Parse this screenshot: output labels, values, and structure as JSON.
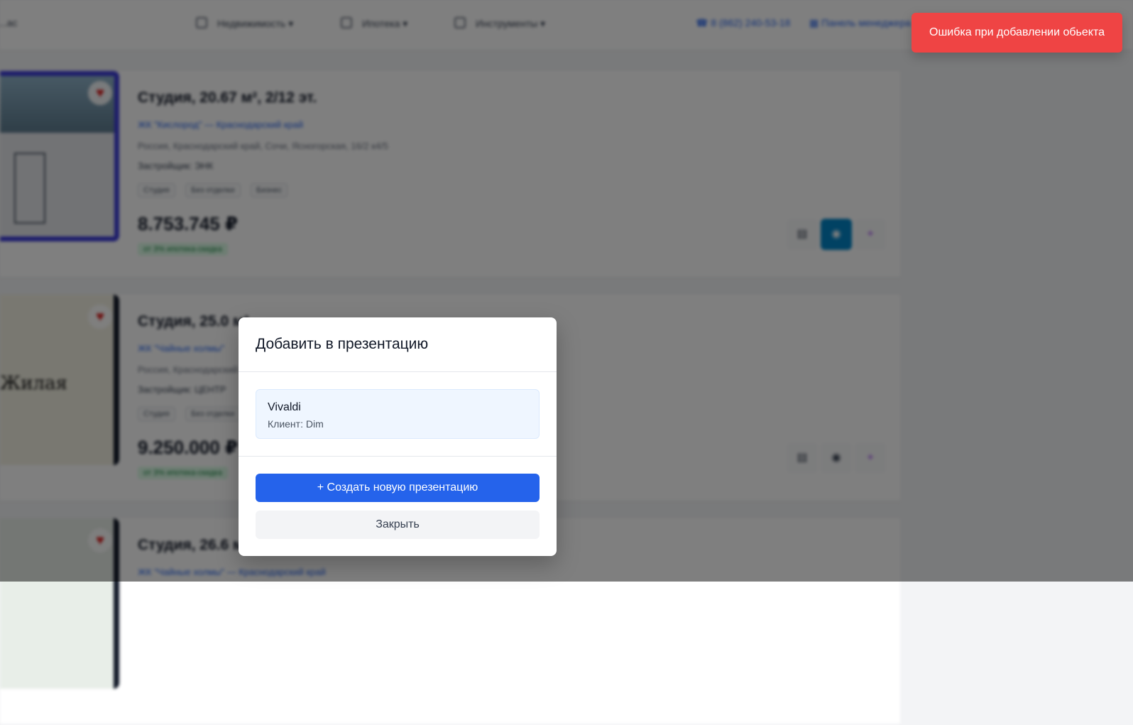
{
  "background": {
    "header": {
      "city_label": "...ас",
      "nav": [
        "Недвижимость",
        "Ипотека",
        "Инструменты"
      ],
      "phone": "8 (862) 240-53-18",
      "manager_link": "Панель менеджера"
    },
    "cards": [
      {
        "title": "Студия, 20.67 м², 2/12 эт.",
        "complex": "ЖК \"Кислород\" — Краснодарский край",
        "address": "Россия, Краснодарский край, Сочи, Ясногорская, 16/2 к4/5",
        "developer": "Застройщик: ЭНК",
        "tags": [
          "Студия",
          "Без отделки",
          "Бизнес"
        ],
        "price": "8.753.745 ₽",
        "promo": "от 3% ипотека-скидка"
      },
      {
        "title": "Студия, 25.0 м²",
        "complex": "ЖК \"Чайные холмы\"",
        "address": "Россия, Краснодарский край",
        "developer": "Застройщик: ЦЕНТР",
        "tags": [
          "Студия",
          "Без отделки"
        ],
        "price": "9.250.000 ₽",
        "promo": "от 3% ипотека-скидка"
      },
      {
        "title": "Студия, 26.6 м²",
        "complex": "ЖК \"Чайные холмы\" — Краснодарский край"
      }
    ]
  },
  "toast": {
    "message": "Ошибка при добавлении обьекта"
  },
  "modal": {
    "title": "Добавить в презентацию",
    "presentations": [
      {
        "name": "Vivaldi",
        "client": "Клиент: Dim"
      }
    ],
    "create_button": "+ Создать новую презентацию",
    "close_button": "Закрыть"
  }
}
